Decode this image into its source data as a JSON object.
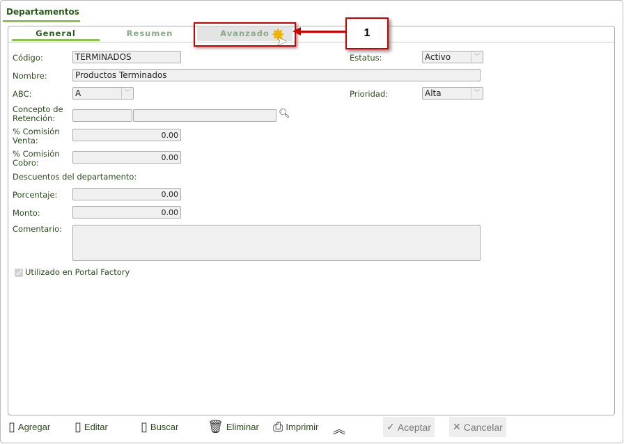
{
  "window": {
    "title": "Departamentos"
  },
  "tabs": [
    {
      "label": "General"
    },
    {
      "label": "Resumen"
    },
    {
      "label": "Avanzado"
    }
  ],
  "callout": {
    "number": "1"
  },
  "form": {
    "codigo": {
      "label": "Código:",
      "value": "TERMINADOS"
    },
    "estatus": {
      "label": "Estatus:",
      "value": "Activo"
    },
    "nombre": {
      "label": "Nombre:",
      "value": "Productos Terminados"
    },
    "abc": {
      "label": "ABC:",
      "value": "A"
    },
    "prioridad": {
      "label": "Prioridad:",
      "value": "Alta"
    },
    "concepto": {
      "label1": "Concepto de",
      "label2": "Retención:",
      "value1": "",
      "value2": ""
    },
    "comision_venta": {
      "label1": "% Comisión",
      "label2": "Venta:",
      "value": "0.00"
    },
    "comision_cobro": {
      "label1": "% Comisión",
      "label2": "Cobro:",
      "value": "0.00"
    },
    "descuentos_heading": "Descuentos del departamento:",
    "porcentaje": {
      "label": "Porcentaje:",
      "value": "0.00"
    },
    "monto": {
      "label": "Monto:",
      "value": "0.00"
    },
    "comentario": {
      "label": "Comentario:",
      "value": ""
    },
    "portal": {
      "label": "Utilizado en Portal Factory",
      "checked": true
    }
  },
  "toolbar": {
    "agregar": "Agregar",
    "editar": "Editar",
    "buscar": "Buscar",
    "eliminar": "Eliminar",
    "imprimir": "Imprimir",
    "aceptar": "Aceptar",
    "cancelar": "Cancelar"
  }
}
